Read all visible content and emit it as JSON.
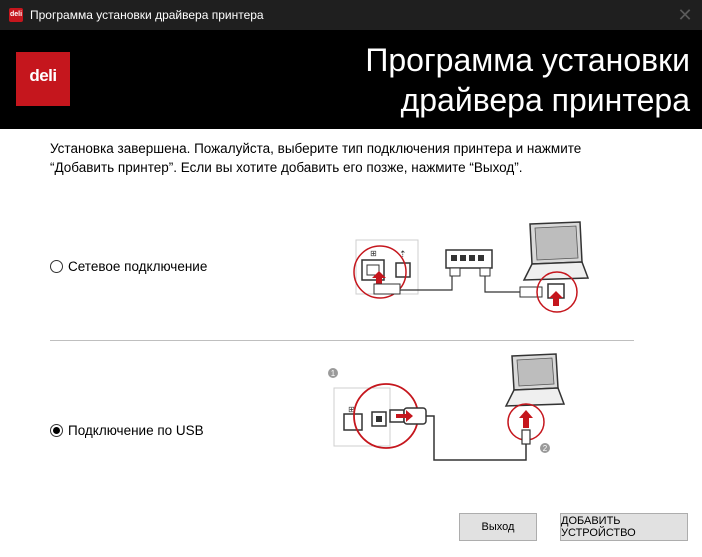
{
  "window": {
    "title": "Программа установки драйвера принтера",
    "close_glyph": "✕",
    "app_icon_text": "deli"
  },
  "banner": {
    "logo_text": "deli",
    "title_line1": "Программа установки",
    "title_line2": "драйвера принтера",
    "brand_color": "#c5161d"
  },
  "instructions": "Установка завершена. Пожалуйста, выберите тип подключения принтера и нажмите “Добавить принтер”. Если вы хотите добавить его позже, нажмите “Выход”.",
  "options": {
    "network": {
      "label": "Сетевое подключение",
      "selected": false
    },
    "usb": {
      "label": "Подключение по USB",
      "selected": true
    }
  },
  "usb_diagram": {
    "step1": "1",
    "step2": "2"
  },
  "buttons": {
    "exit": "Выход",
    "add_device": "ДОБАВИТЬ УСТРОЙСТВО"
  }
}
